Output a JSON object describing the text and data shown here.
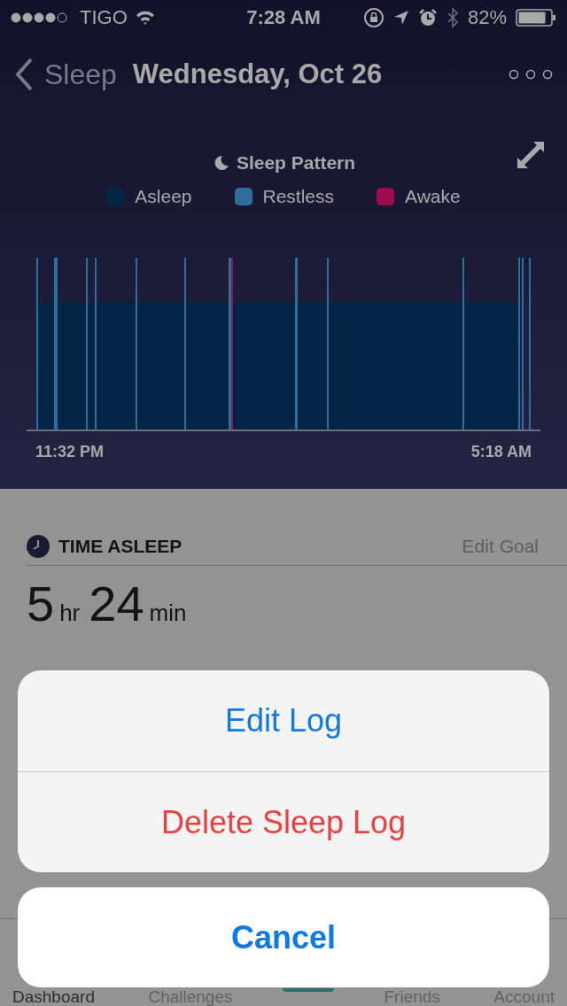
{
  "status_bar": {
    "carrier": "TIGO",
    "time": "7:28 AM",
    "battery": "82%"
  },
  "header": {
    "back": "Sleep",
    "title": "Wednesday, Oct 26"
  },
  "sleep_pattern": {
    "title": "Sleep Pattern",
    "legend": [
      {
        "label": "Asleep",
        "color": "#032445"
      },
      {
        "label": "Restless",
        "color": "#2e6e9a"
      },
      {
        "label": "Awake",
        "color": "#9c0d4d"
      }
    ],
    "time_start": "11:32 PM",
    "time_end": "5:18 AM"
  },
  "time_asleep": {
    "title": "TIME ASLEEP",
    "edit": "Edit Goal",
    "hours": "5",
    "hours_unit": "hr",
    "minutes": "24",
    "minutes_unit": "min"
  },
  "action_sheet": {
    "actions": [
      {
        "label": "Edit Log",
        "kind": "default"
      },
      {
        "label": "Delete Sleep Log",
        "kind": "destructive"
      }
    ],
    "cancel": "Cancel"
  },
  "tab_bar": [
    {
      "label": "Dashboard",
      "selected": true
    },
    {
      "label": "Challenges",
      "selected": false
    },
    {
      "label": "Friends",
      "selected": false
    },
    {
      "label": "Account",
      "selected": false
    }
  ]
}
